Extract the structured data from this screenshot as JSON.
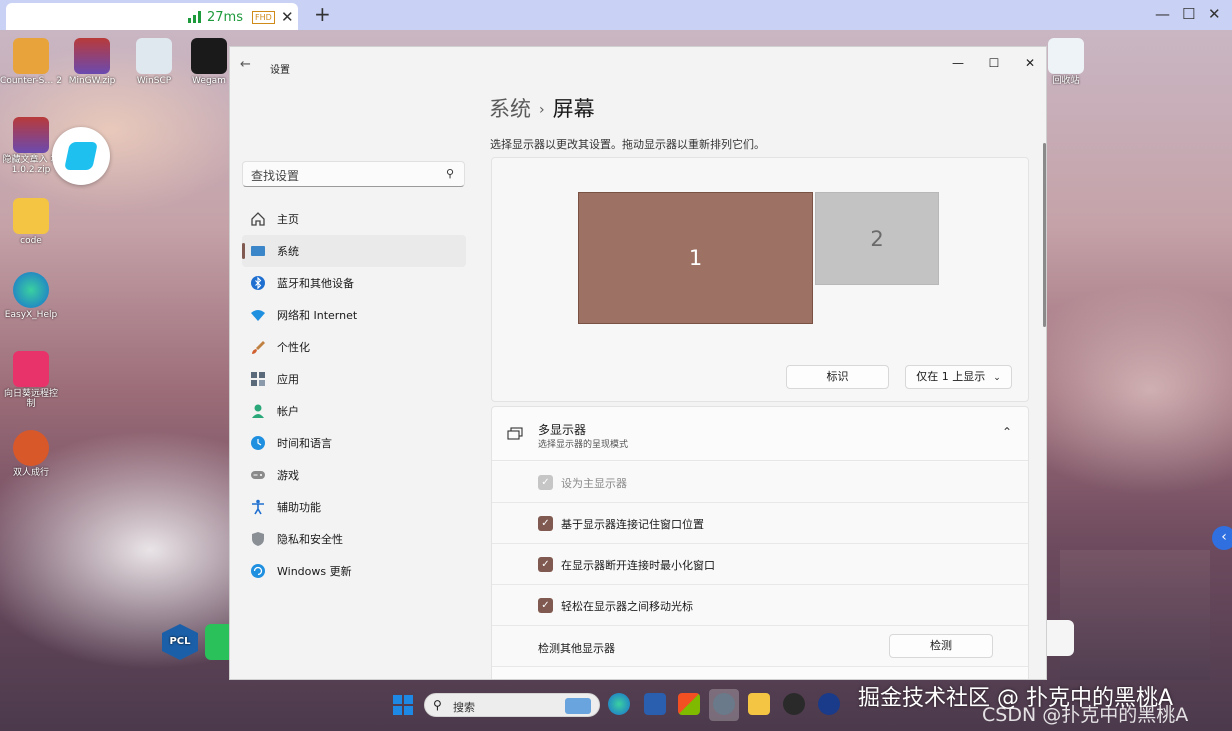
{
  "remote_viewer": {
    "ping": "27ms",
    "quality_badge": "FHD",
    "close_tab": "✕",
    "new_tab": "+",
    "minimize": "—",
    "maximize": "☐",
    "close": "✕"
  },
  "desktop": {
    "icons": [
      {
        "label": "Counter-S… 2"
      },
      {
        "label": "MinGW.zip"
      },
      {
        "label": "WinSCP"
      },
      {
        "label": "Wegam"
      },
      {
        "label": "隐藏文章入 本1.0.2.zip"
      },
      {
        "label": "code"
      },
      {
        "label": "EasyX_Help"
      },
      {
        "label": "向日葵远程控 制"
      },
      {
        "label": "双人成行"
      },
      {
        "label": "回收站"
      }
    ],
    "edge_handle": "‹"
  },
  "settings": {
    "app_title": "设置",
    "back": "←",
    "window_controls": {
      "minimize": "—",
      "maximize": "☐",
      "close": "✕"
    },
    "search_placeholder": "查找设置",
    "search_icon": "⚲",
    "nav": [
      {
        "label": "主页",
        "icon": "home-icon",
        "active": false
      },
      {
        "label": "系统",
        "icon": "system-icon",
        "active": true
      },
      {
        "label": "蓝牙和其他设备",
        "icon": "bluetooth-icon",
        "active": false
      },
      {
        "label": "网络和 Internet",
        "icon": "wifi-icon",
        "active": false
      },
      {
        "label": "个性化",
        "icon": "brush-icon",
        "active": false
      },
      {
        "label": "应用",
        "icon": "apps-icon",
        "active": false
      },
      {
        "label": "帐户",
        "icon": "account-icon",
        "active": false
      },
      {
        "label": "时间和语言",
        "icon": "globe-clock-icon",
        "active": false
      },
      {
        "label": "游戏",
        "icon": "gamepad-icon",
        "active": false
      },
      {
        "label": "辅助功能",
        "icon": "accessibility-icon",
        "active": false
      },
      {
        "label": "隐私和安全性",
        "icon": "shield-icon",
        "active": false
      },
      {
        "label": "Windows 更新",
        "icon": "update-icon",
        "active": false
      }
    ],
    "breadcrumb": {
      "parent": "系统",
      "separator": "›",
      "current": "屏幕"
    },
    "hint": "选择显示器以更改其设置。拖动显示器以重新排列它们。",
    "monitors": [
      {
        "label": "1"
      },
      {
        "label": "2"
      }
    ],
    "identify_button": "标识",
    "display_mode": "仅在 1 上显示",
    "display_mode_chevron": "⌄",
    "multi_display": {
      "title": "多显示器",
      "subtitle": "选择显示器的呈现模式",
      "collapse_chevron": "⌃",
      "options": [
        {
          "label": "设为主显示器",
          "checked": true,
          "disabled": true
        },
        {
          "label": "基于显示器连接记住窗口位置",
          "checked": true,
          "disabled": false
        },
        {
          "label": "在显示器断开连接时最小化窗口",
          "checked": true,
          "disabled": false
        },
        {
          "label": "轻松在显示器之间移动光标",
          "checked": true,
          "disabled": false
        }
      ],
      "checkmark": "✓",
      "detect_label": "检测其他显示器",
      "detect_button": "检测"
    },
    "accent_color": "#805a50"
  },
  "taskbar": {
    "search_placeholder": "搜索",
    "search_icon": "⚲"
  },
  "watermark": {
    "line1": "掘金技术社区 @ 扑克中的黑桃A",
    "line2": "CSDN @扑克中的黑桃A"
  }
}
